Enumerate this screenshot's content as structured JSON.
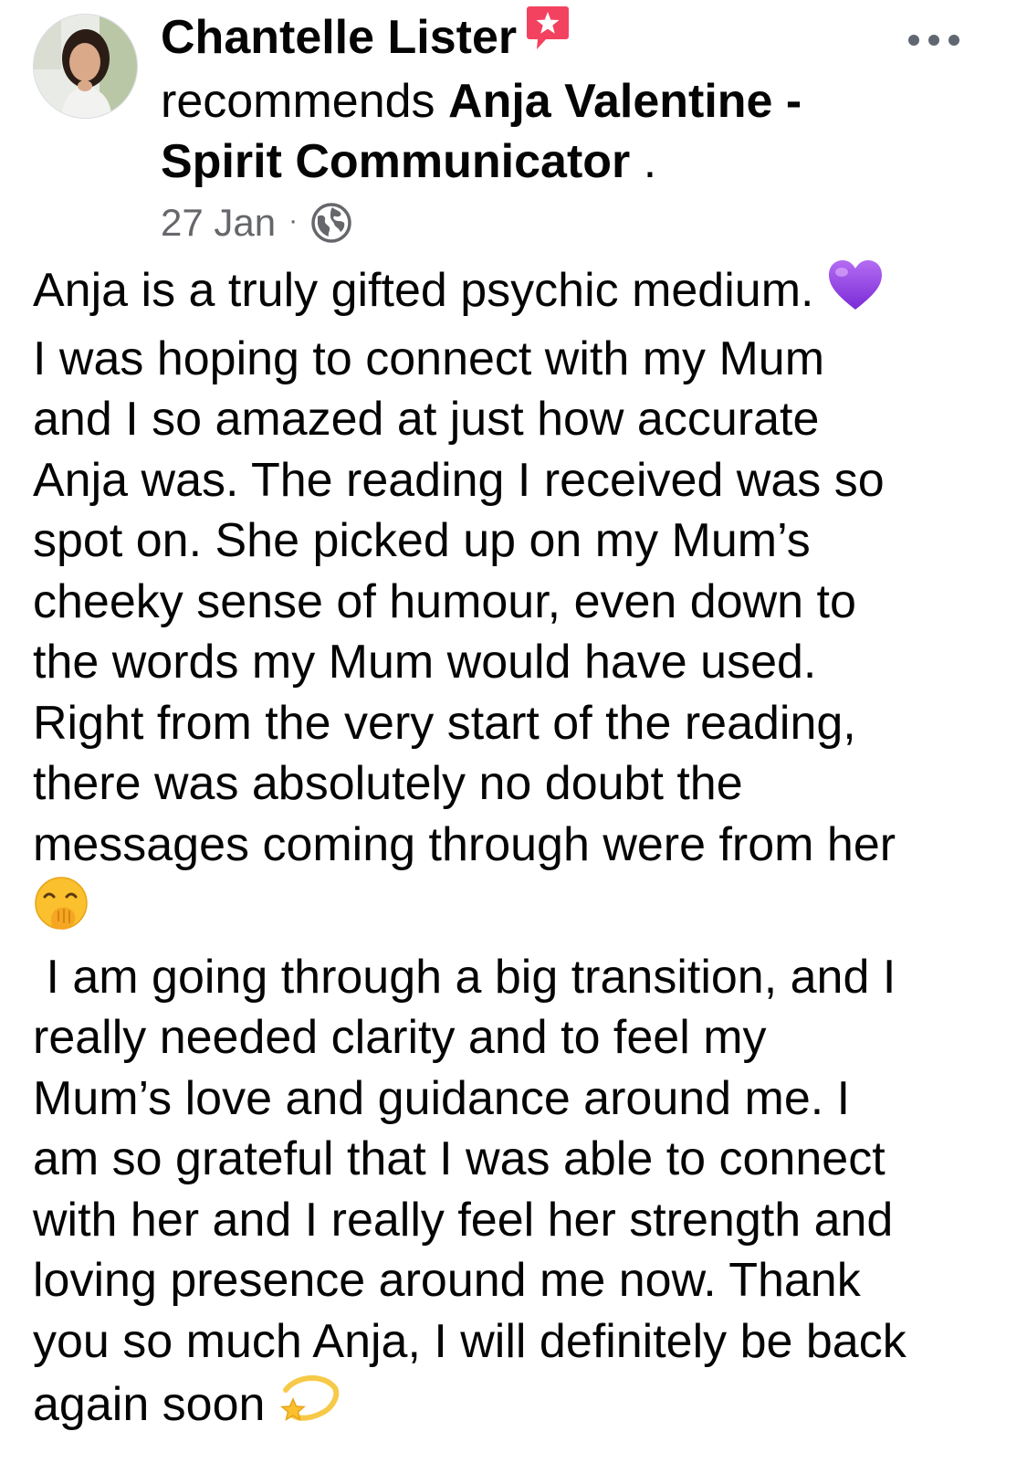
{
  "post": {
    "author_name": "Chantelle Lister",
    "verb": "recommends",
    "page_name_line1": "Anja Valentine -",
    "page_name_line2": "Spirit Communicator",
    "period": ".",
    "date": "27 Jan",
    "separator": "·",
    "privacy_icon": "globe-icon",
    "recommendation_badge_icon": "recommendation-star-icon",
    "more_options_icon": "more-dots-icon",
    "accent_color": "#f3425f",
    "meta_color": "#65676b",
    "body_lines": [
      "Anja is a truly gifted psychic medium.",
      "I was hoping to connect with my Mum",
      "and I so amazed at just how accurate",
      "Anja was. The reading I received was so",
      "spot on. She picked up on my Mum’s",
      "cheeky sense of humour, even down to",
      "the words my Mum would have used.",
      "Right from the very start of the reading,",
      "there was absolutely no doubt the",
      "messages coming through were from her",
      "",
      " I am going through a big transition, and I",
      "really needed clarity and to feel my",
      "Mum’s love and guidance around me. I",
      "am so grateful that I was able to connect",
      "with her and I really feel her strength and",
      "loving presence around me now. Thank",
      "you so much Anja, I will definitely be back",
      "again soon"
    ],
    "emojis": {
      "line1": "purple-heart-emoji",
      "line11": "hand-over-mouth-emoji",
      "line19": "dizzy-star-emoji"
    }
  }
}
